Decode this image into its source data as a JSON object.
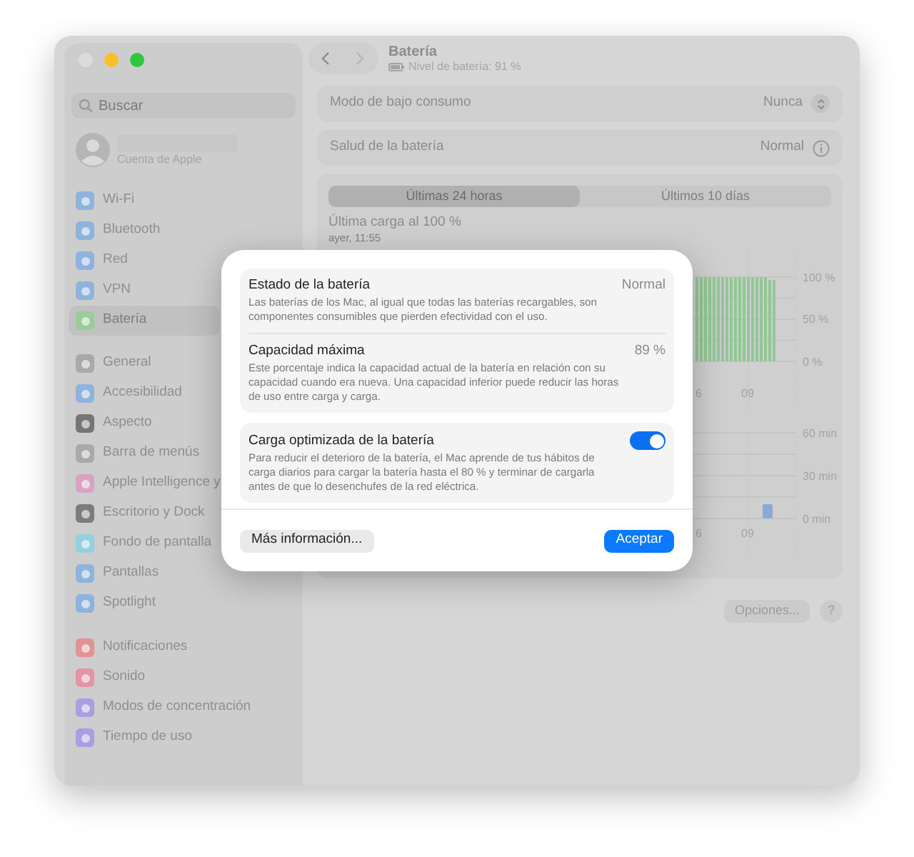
{
  "window": {
    "controls": [
      {
        "color": "#dcdcdc"
      },
      {
        "color": "#f6c026"
      },
      {
        "color": "#2fc640"
      }
    ]
  },
  "sidebar": {
    "search": {
      "placeholder": "Buscar"
    },
    "account": {
      "caption": "Cuenta de Apple"
    },
    "groups": [
      [
        {
          "label": "Wi-Fi",
          "color": "#8fb3dd",
          "selected": false
        },
        {
          "label": "Bluetooth",
          "color": "#8fb3dd",
          "selected": false
        },
        {
          "label": "Red",
          "color": "#8fb3dd",
          "selected": false
        },
        {
          "label": "VPN",
          "color": "#8fb3dd",
          "selected": false
        },
        {
          "label": "Batería",
          "color": "#9acb9a",
          "selected": true
        }
      ],
      [
        {
          "label": "General",
          "color": "#a9a9a9",
          "selected": false
        },
        {
          "label": "Accesibilidad",
          "color": "#8fb3dd",
          "selected": false
        },
        {
          "label": "Aspecto",
          "color": "#767676",
          "selected": false
        },
        {
          "label": "Barra de menús",
          "color": "#a9a9a9",
          "selected": false
        },
        {
          "label": "Apple Intelligence y",
          "color": "#d8a3c2",
          "selected": false
        },
        {
          "label": "Escritorio y Dock",
          "color": "#7c7c7c",
          "selected": false
        },
        {
          "label": "Fondo de pantalla",
          "color": "#93d0e0",
          "selected": false
        },
        {
          "label": "Pantallas",
          "color": "#8fb3dd",
          "selected": false
        },
        {
          "label": "Spotlight",
          "color": "#8fb3dd",
          "selected": false
        }
      ],
      [
        {
          "label": "Notificaciones",
          "color": "#e29393",
          "selected": false
        },
        {
          "label": "Sonido",
          "color": "#e295a5",
          "selected": false
        },
        {
          "label": "Modos de concentración",
          "color": "#a99ee0",
          "selected": false
        },
        {
          "label": "Tiempo de uso",
          "color": "#a99ee0",
          "selected": false
        }
      ]
    ]
  },
  "header": {
    "title": "Batería",
    "subtitle": "Nivel de batería: 91 %"
  },
  "rows": [
    {
      "kind": "popup",
      "label": "Modo de bajo consumo",
      "value": "Nunca"
    },
    {
      "kind": "info",
      "label": "Salud de la batería",
      "value": "Normal"
    }
  ],
  "usage": {
    "tabs": [
      {
        "label": "Últimas 24 horas",
        "selected": true
      },
      {
        "label": "Últimos 10 días",
        "selected": false
      }
    ],
    "last_charge": "Última carga al 100 %",
    "last_charge_time": "ayer, 11:55",
    "level_chart": {
      "yticks": [
        "100 %",
        "50 %",
        "0 %"
      ],
      "xticks": [
        "6",
        "09"
      ]
    },
    "screen_chart": {
      "yticks": [
        "60 min",
        "30 min",
        "0 min"
      ],
      "xticks": [
        "6",
        "09"
      ]
    }
  },
  "buttons": [
    {
      "kind": "plain",
      "label": "Opciones..."
    },
    {
      "kind": "help",
      "label": "?"
    }
  ],
  "dialog": {
    "sections": [
      [
        {
          "kind": "value",
          "title": "Estado de la batería",
          "value": "Normal",
          "description": "Las baterías de los Mac, al igual que todas las baterías recargables, son componentes consumibles que pierden efectividad con el uso."
        },
        {
          "kind": "value",
          "title": "Capacidad máxima",
          "value": "89 %",
          "description": "Este porcentaje indica la capacidad actual de la batería en relación con su capacidad cuando era nueva. Una capacidad inferior puede reducir las horas de uso entre carga y carga."
        }
      ],
      [
        {
          "kind": "toggle",
          "title": "Carga optimizada de la batería",
          "on": true,
          "description": "Para reducir el deterioro de la batería, el Mac aprende de tus hábitos de carga diarios para cargar la batería hasta el 80 % y terminar de cargarla antes de que lo desenchufes de la red eléctrica."
        }
      ]
    ],
    "buttons": [
      {
        "kind": "secondary",
        "label": "Más información..."
      },
      {
        "kind": "primary",
        "label": "Aceptar"
      }
    ]
  }
}
